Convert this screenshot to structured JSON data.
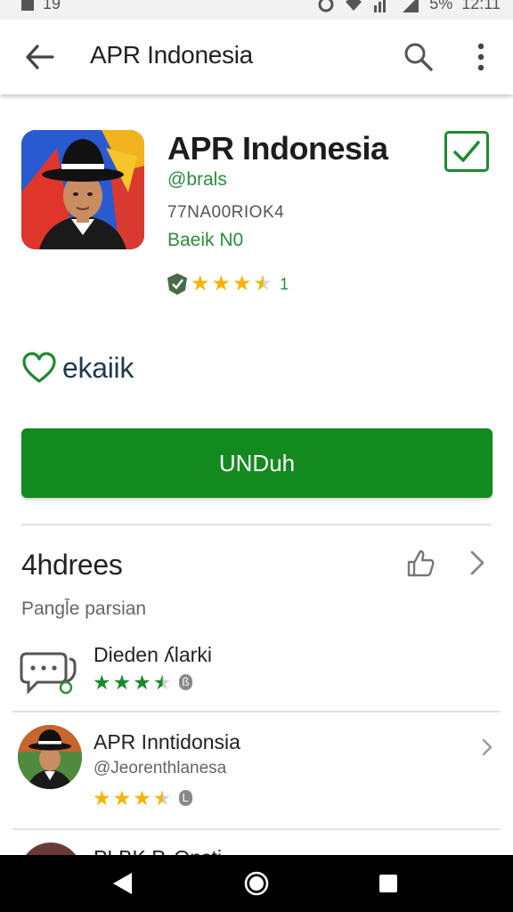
{
  "status_bar": {
    "left_text": "19",
    "battery": "5%",
    "time": "12:11"
  },
  "app_bar": {
    "title": "APR Indonesia"
  },
  "app": {
    "name": "APR Indonesia",
    "developer": "@brals",
    "code": "77NA00RIOK4",
    "badge": "Baeik N0",
    "rating_count": "1",
    "stars": 3.5
  },
  "wishlist": {
    "label": "ekaiik"
  },
  "install_button": {
    "label": "UNDuh"
  },
  "section": {
    "title": "4hdrees",
    "subtitle": "Pangl̄e parsian"
  },
  "list": [
    {
      "title": "Dieden ʎlarki",
      "stars": 3.5,
      "badge": "ß",
      "star_color": "#1b8a2c"
    },
    {
      "title": "APR Inntidonsia",
      "subtitle": "@Jeorenthlanesa",
      "stars": 3.5,
      "badge": "L",
      "star_color": "#f4b400"
    },
    {
      "title": "PLBK P. Onsti"
    }
  ],
  "colors": {
    "accent": "#138a20",
    "link_green": "#2e8b3c",
    "star_yellow": "#f4b400",
    "nav_bg": "#000000"
  }
}
